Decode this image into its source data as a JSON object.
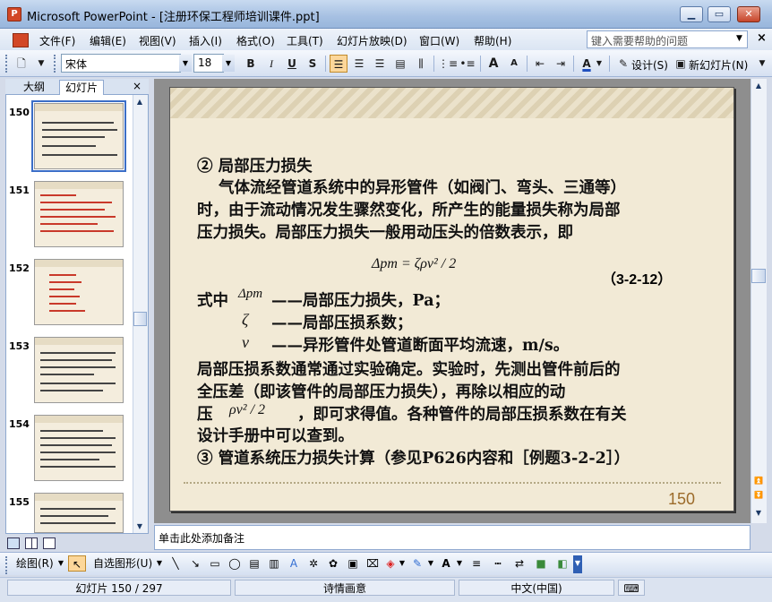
{
  "window": {
    "title": "Microsoft PowerPoint - [注册环保工程师培训课件.ppt]",
    "app_icon_label": "P",
    "minimize": "▁",
    "maximize": "▭",
    "close": "✕"
  },
  "menu": {
    "items": [
      "文件(F)",
      "编辑(E)",
      "视图(V)",
      "插入(I)",
      "格式(O)",
      "工具(T)",
      "幻灯片放映(D)",
      "窗口(W)",
      "帮助(H)"
    ],
    "help_placeholder": "键入需要帮助的问题",
    "close": "×"
  },
  "toolbar": {
    "font_name": "宋体",
    "font_size": "18",
    "bold": "B",
    "italic": "I",
    "underline": "U",
    "shadow": "S",
    "design": "设计(S)",
    "new_slide": "新幻灯片(N)",
    "grow_font": "A",
    "shrink_font": "A",
    "font_color": "A"
  },
  "left_pane": {
    "tabs": [
      "大纲",
      "幻灯片"
    ],
    "close": "×",
    "slides": [
      {
        "number": "150",
        "selected": true
      },
      {
        "number": "151",
        "selected": false
      },
      {
        "number": "152",
        "selected": false
      },
      {
        "number": "153",
        "selected": false
      },
      {
        "number": "154",
        "selected": false
      },
      {
        "number": "155",
        "selected": false
      }
    ]
  },
  "slide": {
    "heading": "② 局部压力损失",
    "para1": [
      "气体流经管道系统中的异形管件（如阀门、弯头、三通等）",
      "时，由于流动情况发生骤然变化，所产生的能量损失称为局部",
      "压力损失。局部压力损失一般用动压头的倍数表示，即"
    ],
    "formula": "Δpm = ζρv² / 2",
    "formula_number": "（3-2-12）",
    "where_prefix": "式中",
    "var1_symbol": "Δpm",
    "var1_desc": "——局部压力损失，Pa；",
    "var2_symbol": "ζ",
    "var2_desc": "——局部压损系数；",
    "var3_symbol": "v",
    "var3_desc": "——异形管件处管道断面平均流速，m/s。",
    "para2": [
      "局部压损系数通常通过实验确定。实验时，先测出管件前后的",
      "全压差（即该管件的局部压力损失），再除以相应的动"
    ],
    "para2_line3_prefix": "压",
    "para2_line3_formula": "ρv² / 2",
    "para2_line3_suffix": "，即可求得值。各种管件的局部压损系数在有关",
    "para2_line4": "设计手册中可以查到。",
    "item3": "③ 管道系统压力损失计算（参见P626内容和［例题3-2-2］）",
    "page_number": "150"
  },
  "notes": {
    "placeholder": "单击此处添加备注"
  },
  "drawing_toolbar": {
    "draw": "绘图(R)",
    "autoshapes": "自选图形(U)"
  },
  "status": {
    "slide_info": "幻灯片 150 / 297",
    "design_name": "诗情画意",
    "language": "中文(中国)"
  },
  "colors": {
    "slide_bg": "#f2ead6",
    "slide_number": "#9c6b2a",
    "selection": "#3b6ec7"
  }
}
